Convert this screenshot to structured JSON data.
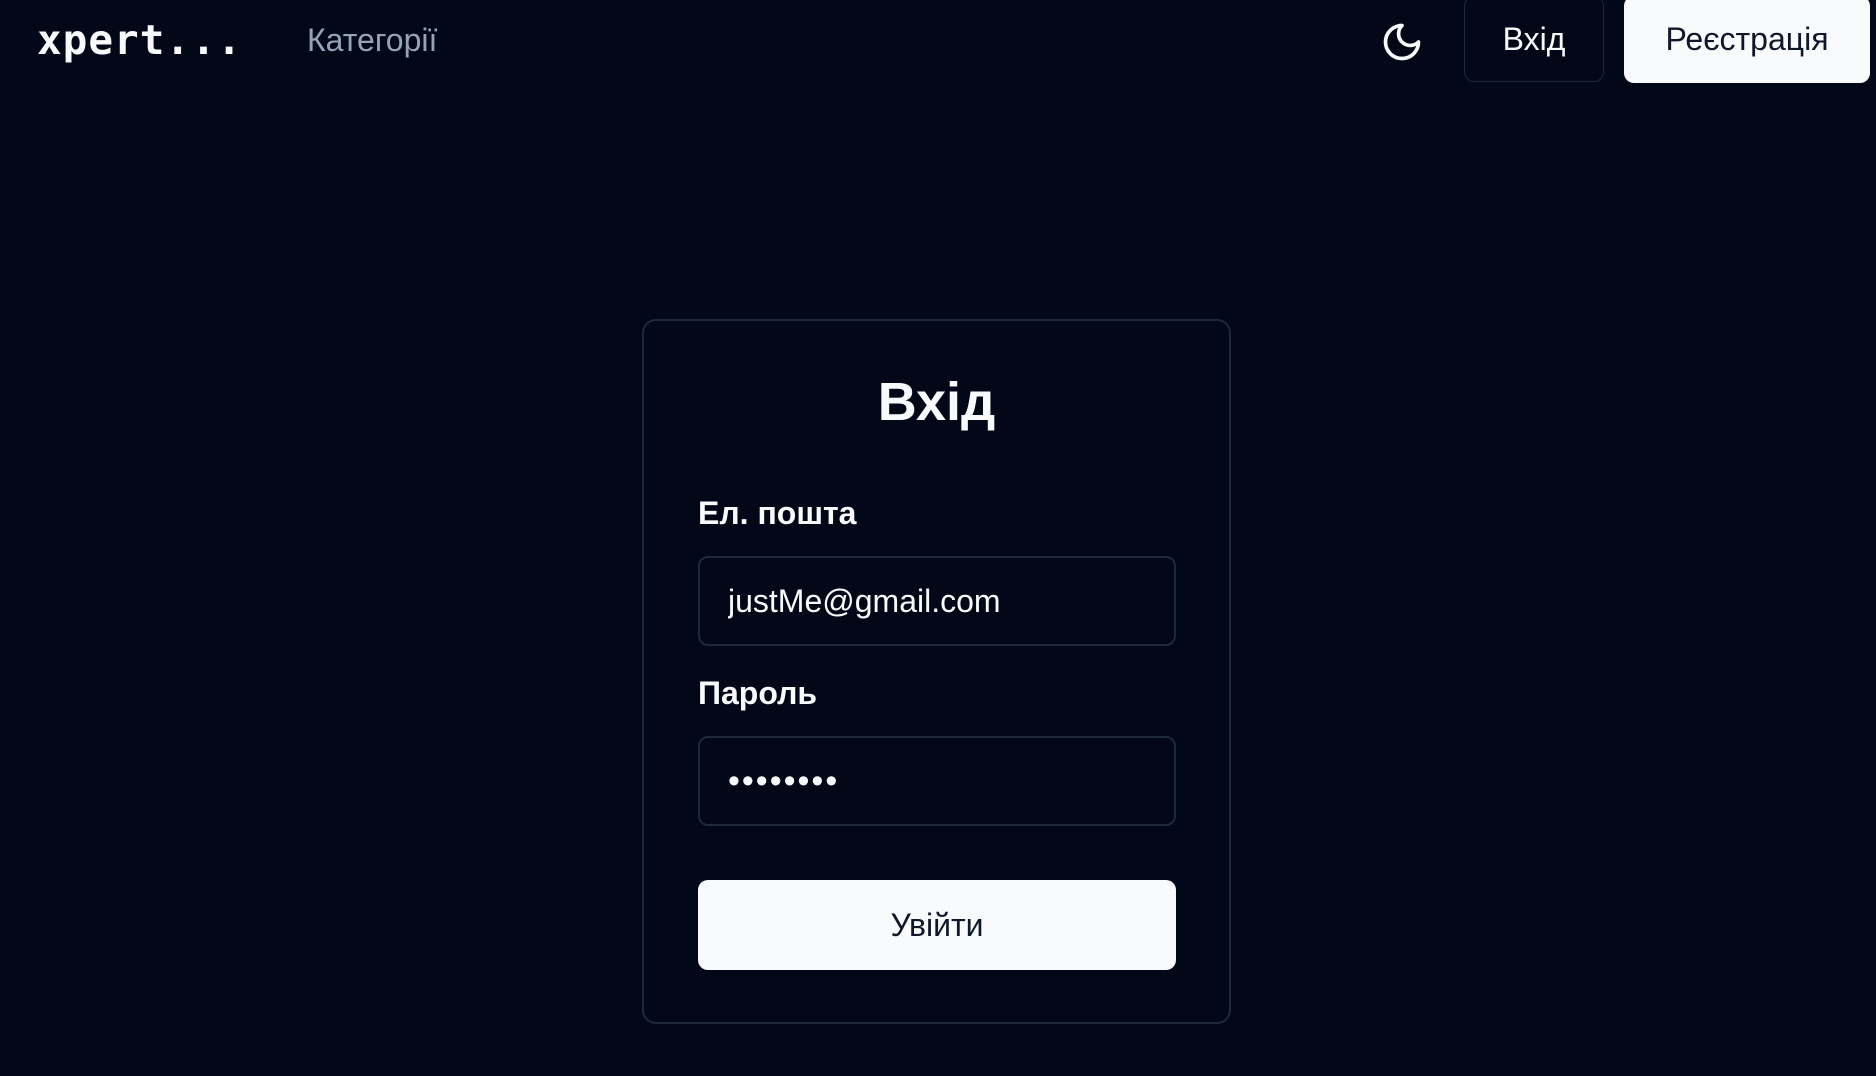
{
  "header": {
    "logo": "xpert...",
    "nav_link": "Категорії",
    "theme_icon": "moon-icon",
    "login_label": "Вхід",
    "register_label": "Реєстрація"
  },
  "login_form": {
    "title": "Вхід",
    "email_label": "Ел. пошта",
    "email_value": "justMe@gmail.com",
    "password_label": "Пароль",
    "password_value": "••••••••",
    "submit_label": "Увійти"
  },
  "colors": {
    "background": "#020817",
    "foreground": "#f8fafc",
    "muted": "#94a3b8",
    "border": "#1e293b"
  }
}
